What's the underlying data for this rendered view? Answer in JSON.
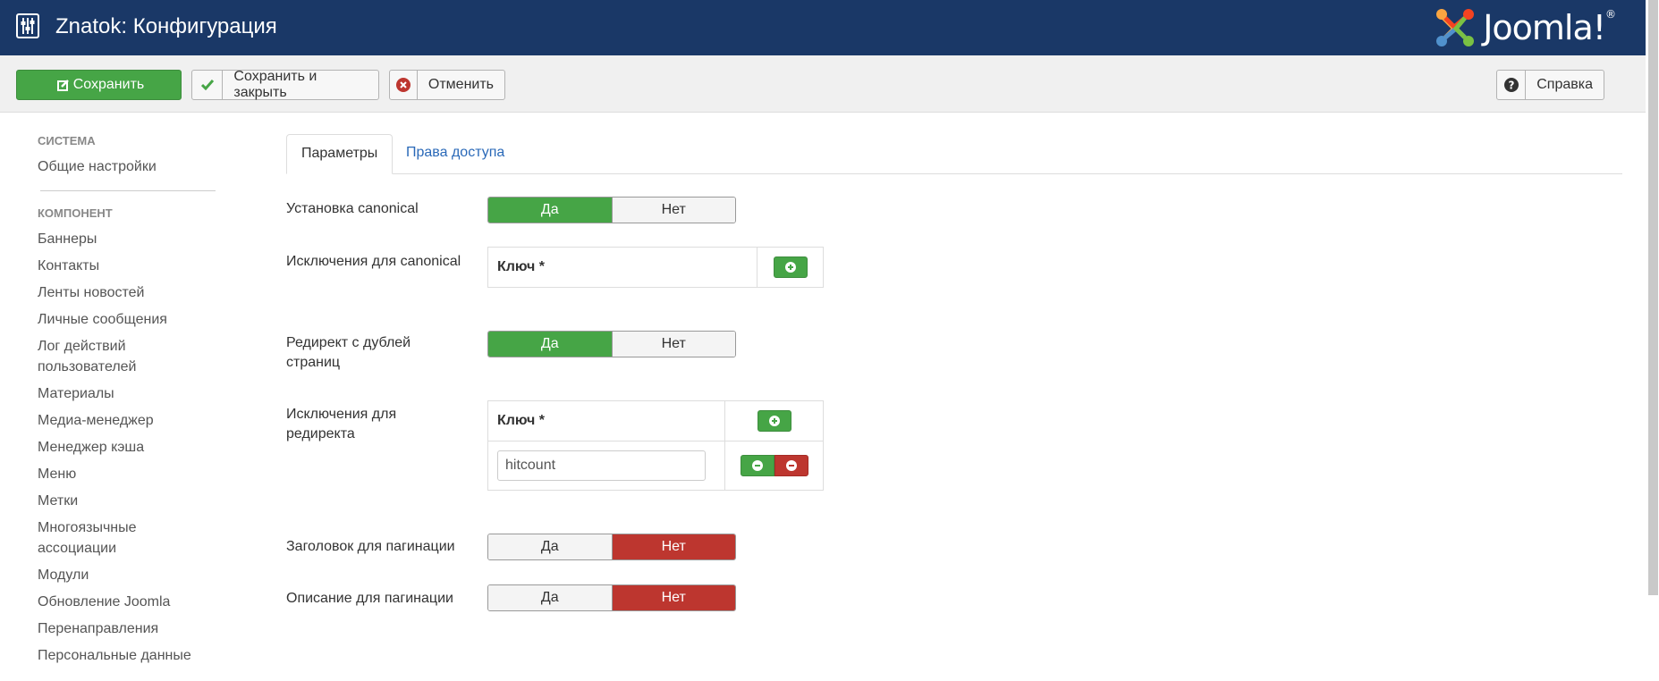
{
  "header": {
    "title": "Znatok: Конфигурация",
    "logo_text": "Joomla!",
    "logo_mark": "®"
  },
  "toolbar": {
    "save_label": "Сохранить",
    "save_close_label": "Сохранить и закрыть",
    "cancel_label": "Отменить",
    "help_label": "Справка"
  },
  "sidebar": {
    "system_heading": "СИСТЕМА",
    "system_items": [
      "Общие настройки"
    ],
    "component_heading": "КОМПОНЕНТ",
    "component_items": [
      "Баннеры",
      "Контакты",
      "Ленты новостей",
      "Личные сообщения",
      "Лог действий пользователей",
      "Материалы",
      "Медиа-менеджер",
      "Менеджер кэша",
      "Меню",
      "Метки",
      "Многоязычные ассоциации",
      "Модули",
      "Обновление Joomla",
      "Перенаправления",
      "Персональные данные"
    ]
  },
  "tabs": [
    {
      "label": "Параметры",
      "active": true
    },
    {
      "label": "Права доступа",
      "active": false
    }
  ],
  "fields": {
    "canonical": {
      "label": "Установка canonical",
      "yes": "Да",
      "no": "Нет",
      "value": "Да"
    },
    "canonical_exceptions": {
      "label": "Исключения для canonical",
      "key_header": "Ключ *"
    },
    "redirect": {
      "label": "Редирект с дублей страниц",
      "yes": "Да",
      "no": "Нет",
      "value": "Да"
    },
    "redirect_exceptions": {
      "label": "Исключения для редиректа",
      "key_header": "Ключ *",
      "rows": [
        "hitcount"
      ]
    },
    "pagination_title": {
      "label": "Заголовок для пагинации",
      "yes": "Да",
      "no": "Нет",
      "value": "Нет"
    },
    "pagination_desc": {
      "label": "Описание для пагинации",
      "yes": "Да",
      "no": "Нет",
      "value": "Нет"
    }
  },
  "colors": {
    "header_bg": "#1a3867",
    "success": "#46a546",
    "danger": "#bd362f",
    "link": "#2a69b8"
  }
}
